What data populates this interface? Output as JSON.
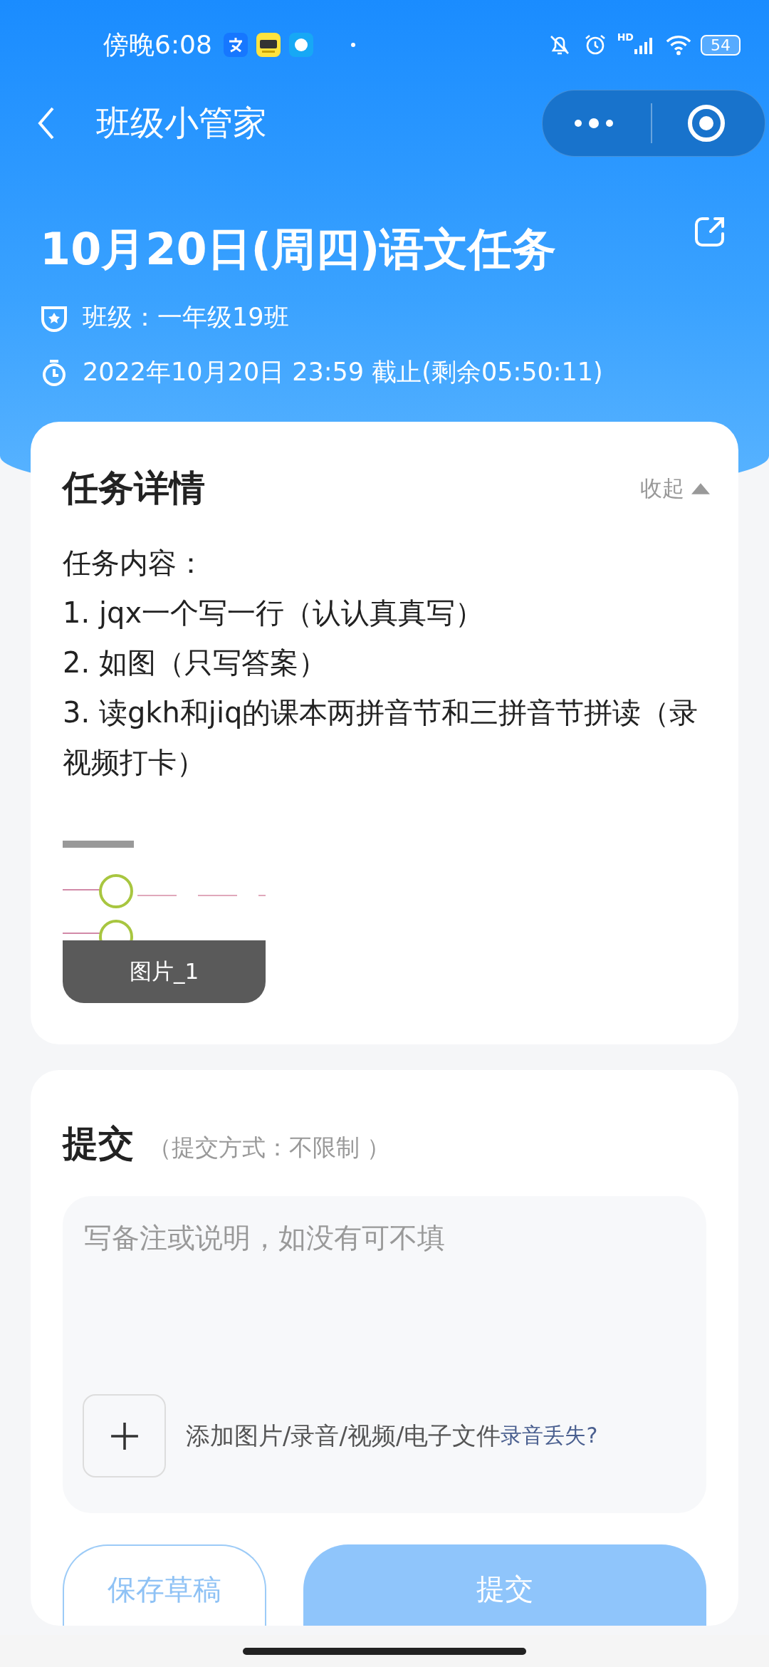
{
  "status_bar": {
    "time": "傍晚6:08",
    "network_label": "HD",
    "battery": "54"
  },
  "nav": {
    "title": "班级小管家"
  },
  "task": {
    "title": "10月20日(周四)语文任务",
    "class_label": "班级：一年级19班",
    "deadline": "2022年10月20日 23:59 截止(剩余05:50:11)"
  },
  "details": {
    "heading": "任务详情",
    "collapse": "收起",
    "lines": [
      "任务内容：",
      "1. jqx一个写一行（认认真真写）",
      "2. 如图（只写答案）",
      "3. 读gkh和jiq的课本两拼音节和三拼音节拼读（录视频打卡）"
    ],
    "attachments": [
      {
        "kind": "picture",
        "caption": "图片_1"
      }
    ]
  },
  "submit": {
    "heading": "提交",
    "mode": "（提交方式：不限制 ）",
    "note": {
      "placeholder": "写备注或说明，如没有可不填"
    },
    "add_label": "添加图片/录音/视频/电子文件",
    "lost_link": "录音丢失?"
  },
  "buttons": [
    {
      "label": "保存草稿",
      "kind": "outline",
      "disabled": false
    },
    {
      "label": "提交",
      "kind": "primary",
      "disabled": true
    }
  ]
}
